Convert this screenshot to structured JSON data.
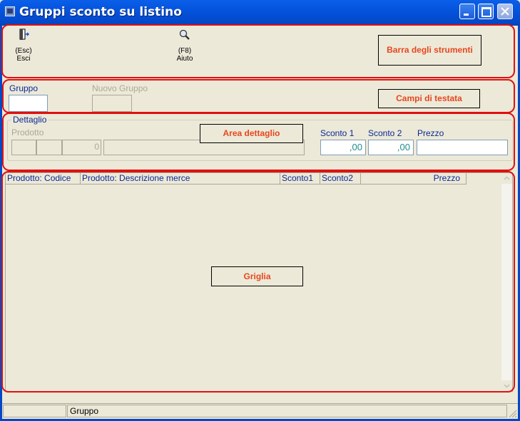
{
  "window": {
    "title": "Gruppi sconto su listino"
  },
  "toolbar": {
    "exit": {
      "shortcut": "(Esc)",
      "label": "Esci",
      "icon": "exit-door-icon"
    },
    "help": {
      "shortcut": "(F8)",
      "label": "Aiuto",
      "icon": "magnifier-icon"
    }
  },
  "header_fields": {
    "gruppo_label": "Gruppo",
    "gruppo_value": "",
    "nuovo_gruppo_label": "Nuovo Gruppo",
    "nuovo_gruppo_value": ""
  },
  "detail": {
    "legend": "Dettaglio",
    "prodotto_label": "Prodotto",
    "prodotto_qty": "0",
    "sconto1_label": "Sconto 1",
    "sconto1_value": ",00",
    "sconto2_label": "Sconto 2",
    "sconto2_value": ",00",
    "prezzo_label": "Prezzo",
    "prezzo_value": ""
  },
  "grid": {
    "columns": [
      "Prodotto: Codice",
      "Prodotto: Descrizione merce",
      "Sconto1",
      "Sconto2",
      "Prezzo"
    ],
    "rows": []
  },
  "annotations": {
    "toolbar": "Barra degli strumenti",
    "header": "Campi di testata",
    "detail": "Area dettaglio",
    "grid": "Griglia"
  },
  "statusbar": {
    "panel1": "",
    "panel2": "Gruppo"
  },
  "colors": {
    "titlebar": "#0553dd",
    "annotation_text": "#e8461e",
    "annotation_border": "#e01010",
    "field_label": "#0a2896"
  }
}
